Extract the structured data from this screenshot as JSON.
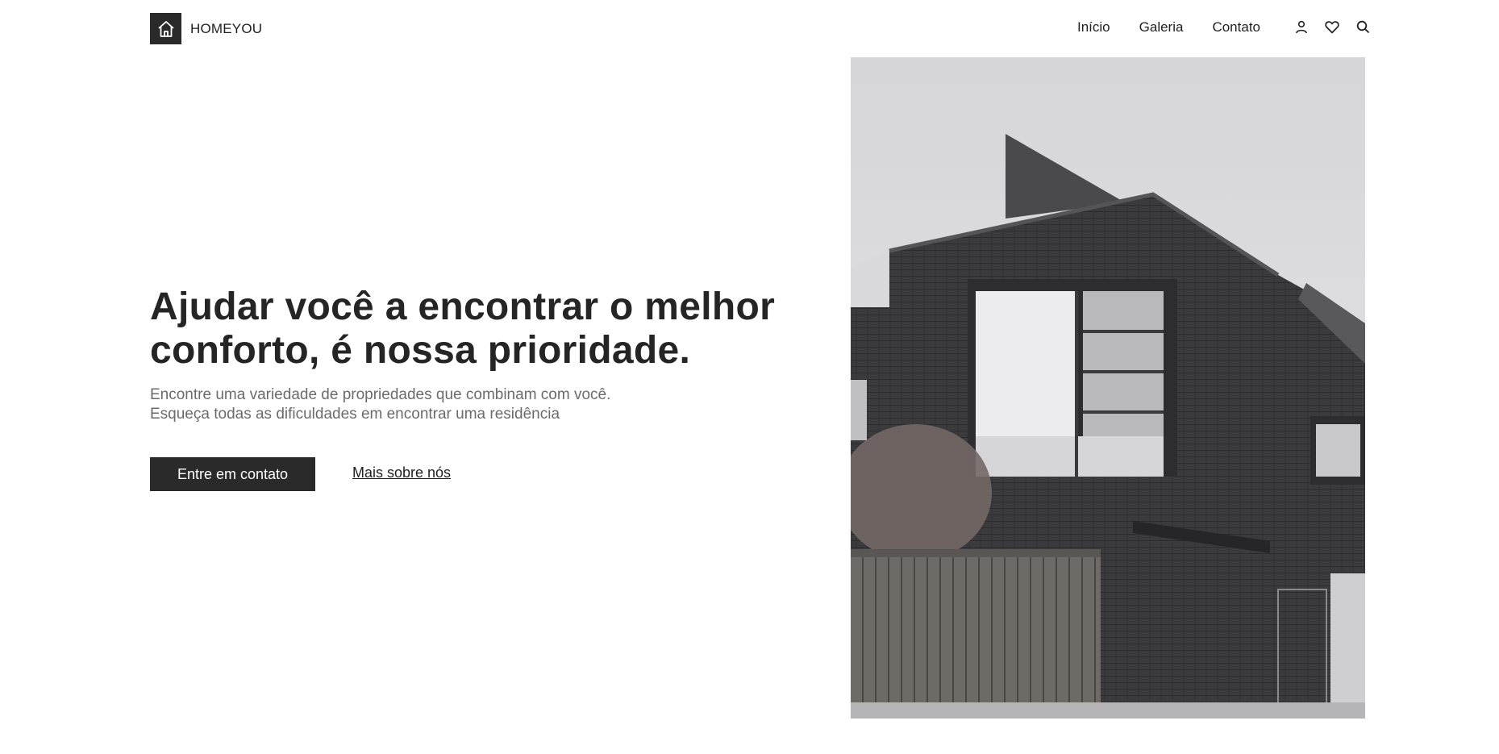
{
  "brand": {
    "name": "HOMEYOU",
    "logo_icon": "house-icon"
  },
  "nav": {
    "links": [
      "Início",
      "Galeria",
      "Contato"
    ],
    "icons": [
      "user-icon",
      "heart-icon",
      "search-icon"
    ]
  },
  "hero": {
    "title": "Ajudar você a encontrar o melhor conforto, é nossa prioridade.",
    "subtitle": "Encontre uma variedade de propriedades que combinam com você. Esqueça todas as dificuldades em encontrar uma residência",
    "primary_button": "Entre em contato",
    "secondary_link": "Mais sobre nós"
  },
  "colors": {
    "primary": "#2a2a2a",
    "text_muted": "#6b6b6b",
    "background": "#ffffff"
  }
}
